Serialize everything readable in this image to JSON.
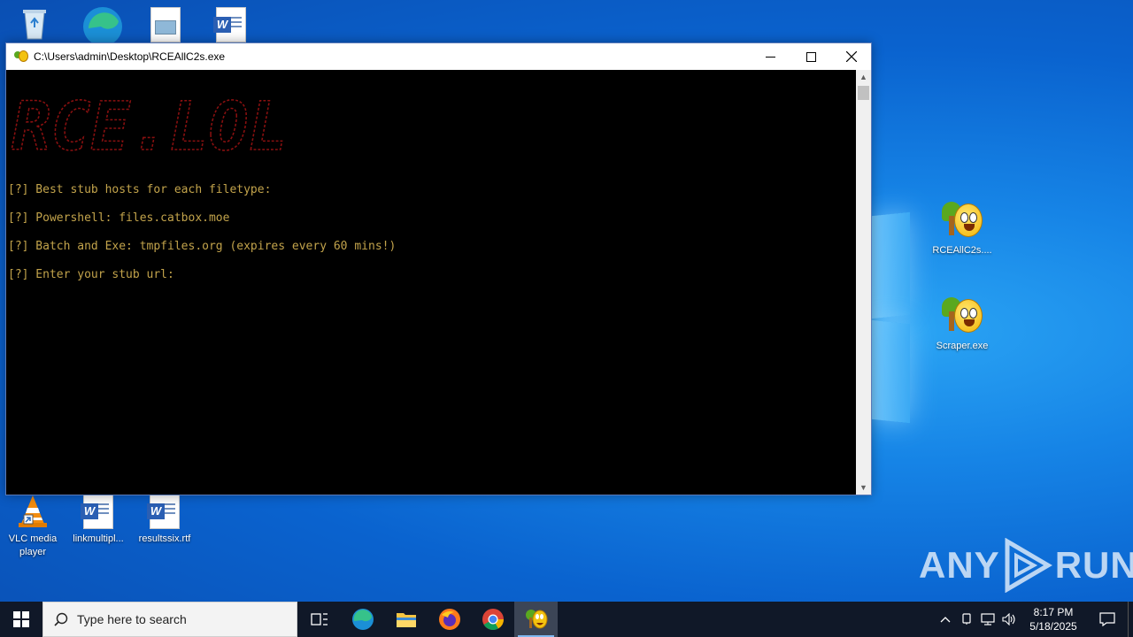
{
  "desktop": {
    "icons": {
      "recycle_bin": {
        "label": ""
      },
      "edge": {
        "label": ""
      },
      "image_file": {
        "label": ""
      },
      "word_doc_top": {
        "label": ""
      },
      "rceallc2s": {
        "label": "RCEAllC2s...."
      },
      "scraper": {
        "label": "Scraper.exe"
      },
      "vlc": {
        "label": "VLC media player"
      },
      "linkmultipl": {
        "label": "linkmultipl..."
      },
      "resultssix": {
        "label": "resultssix.rtf"
      }
    }
  },
  "window": {
    "title": "C:\\Users\\admin\\Desktop\\RCEAllC2s.exe",
    "controls": {
      "minimize": "—",
      "maximize": "☐",
      "close": "✕"
    },
    "console": {
      "banner": "RCE.LOL",
      "lines": [
        "[?] Best stub hosts for each filetype:",
        "[?] Powershell: files.catbox.moe",
        "[?] Batch and Exe: tmpfiles.org (expires every 60 mins!)",
        "[?] Enter your stub url:"
      ],
      "text_color": "#c2a34b",
      "banner_color": "#8a1010"
    }
  },
  "watermark": {
    "left": "ANY",
    "right": "RUN"
  },
  "taskbar": {
    "search_placeholder": "Type here to search",
    "clock_time": "8:17 PM",
    "clock_date": "5/18/2025",
    "pinned": [
      "task-view",
      "edge",
      "file-explorer",
      "firefox",
      "chrome",
      "rceallc2s"
    ]
  }
}
